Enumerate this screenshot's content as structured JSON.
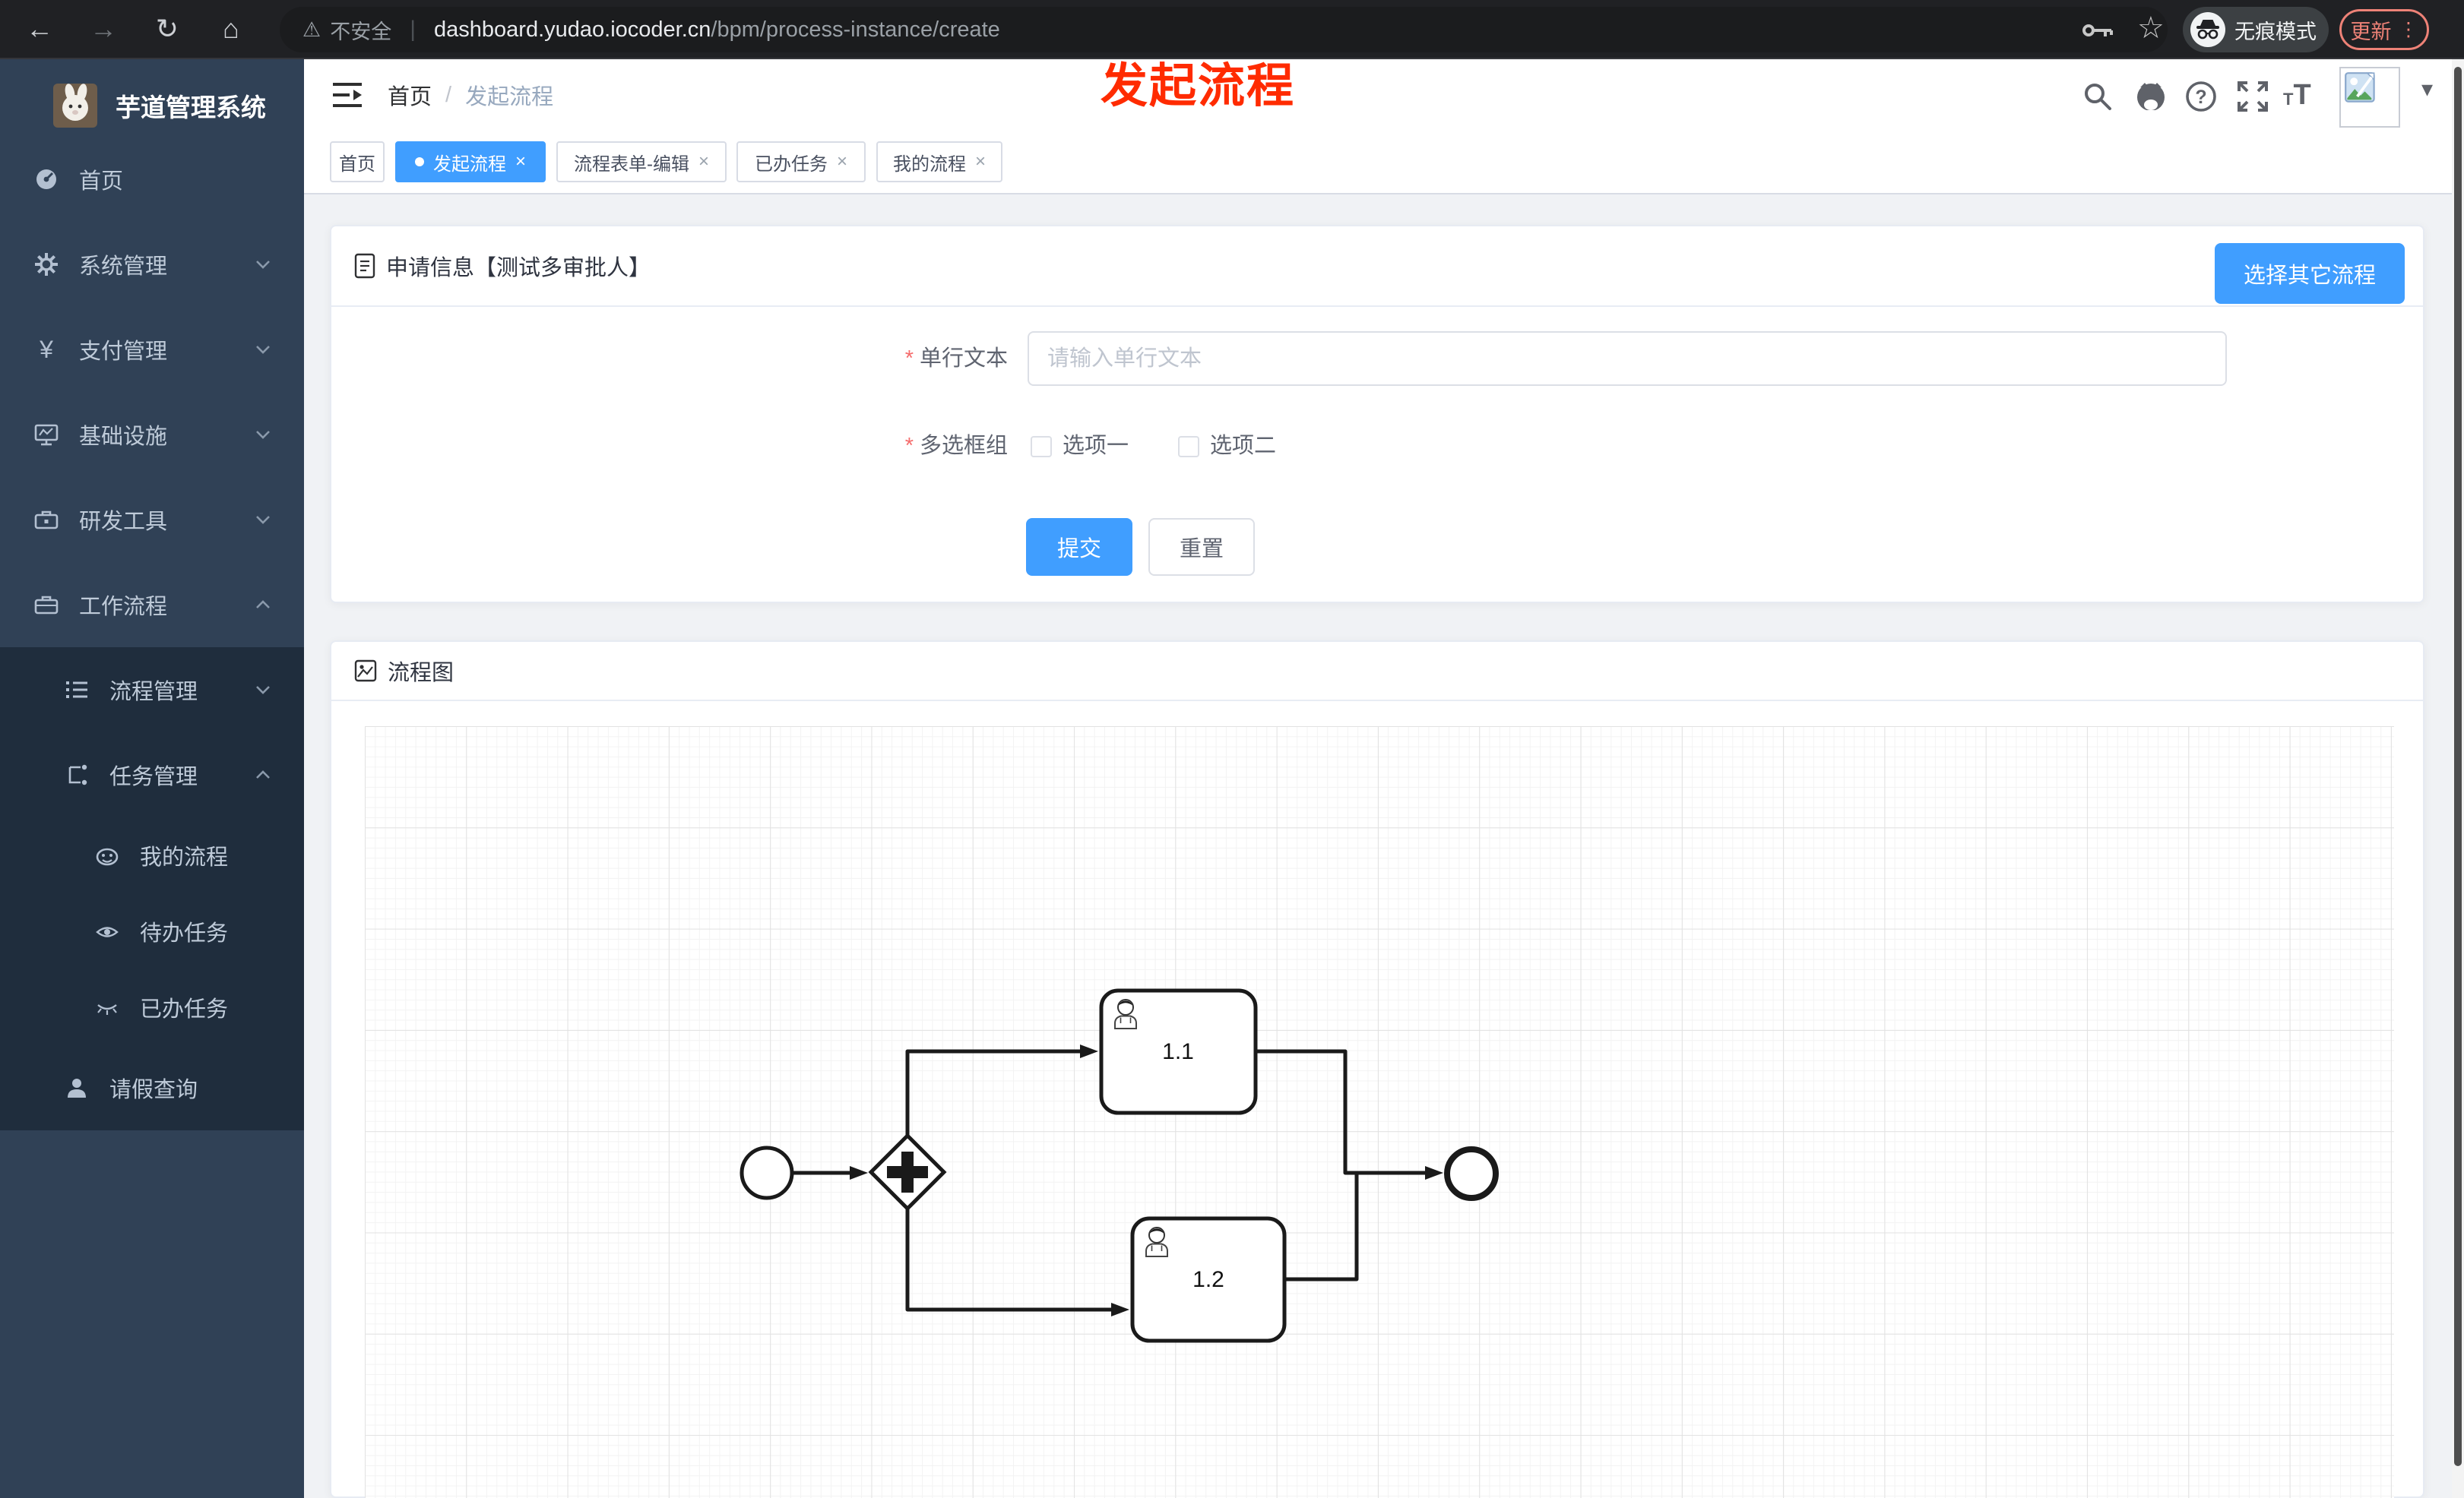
{
  "browser": {
    "security_label": "不安全",
    "url_host": "dashboard.yudao.iocoder.cn",
    "url_path": "/bpm/process-instance/create",
    "incognito_label": "无痕模式",
    "update_button": "更新"
  },
  "annotation": {
    "text": "发起流程",
    "color": "#ff2b00"
  },
  "glyphs": {
    "back": "←",
    "forward": "→",
    "reload": "↻",
    "home": "⌂",
    "warning": "⚠",
    "url_divider": "|",
    "star": "☆",
    "menu_dots": "⋮",
    "caret_down": "▾",
    "close": "×",
    "help": "?",
    "asterisk": "*",
    "yen": "¥",
    "tt_small": "T",
    "tt_large": "T"
  },
  "sidebar": {
    "title": "芋道管理系统",
    "items": [
      {
        "label": "首页",
        "icon": "dashboard-icon",
        "level": 1
      },
      {
        "label": "系统管理",
        "icon": "gear-icon",
        "level": 1,
        "chevron": "down"
      },
      {
        "label": "支付管理",
        "icon": "yen-icon",
        "level": 1,
        "chevron": "down"
      },
      {
        "label": "基础设施",
        "icon": "monitor-icon",
        "level": 1,
        "chevron": "down"
      },
      {
        "label": "研发工具",
        "icon": "toolbox-icon",
        "level": 1,
        "chevron": "down"
      },
      {
        "label": "工作流程",
        "icon": "briefcase-icon",
        "level": 1,
        "chevron": "up"
      },
      {
        "label": "流程管理",
        "icon": "flow-list-icon",
        "level": 2,
        "chevron": "down"
      },
      {
        "label": "任务管理",
        "icon": "task-tree-icon",
        "level": 2,
        "chevron": "up"
      },
      {
        "label": "我的流程",
        "icon": "robot-icon",
        "level": 3
      },
      {
        "label": "待办任务",
        "icon": "eye-icon",
        "level": 3
      },
      {
        "label": "已办任务",
        "icon": "eye-closed-icon",
        "level": 3
      },
      {
        "label": "请假查询",
        "icon": "person-icon",
        "level": 2
      }
    ]
  },
  "header": {
    "breadcrumb": [
      "首页",
      "发起流程"
    ]
  },
  "tabs": [
    {
      "label": "首页",
      "active": false,
      "closable": false
    },
    {
      "label": "发起流程",
      "active": true,
      "closable": true
    },
    {
      "label": "流程表单-编辑",
      "active": false,
      "closable": true
    },
    {
      "label": "已办任务",
      "active": false,
      "closable": true
    },
    {
      "label": "我的流程",
      "active": false,
      "closable": true
    }
  ],
  "form_card": {
    "title": "申请信息【测试多审批人】",
    "switch_button": "选择其它流程",
    "fields": {
      "text": {
        "label": "单行文本",
        "placeholder": "请输入单行文本",
        "value": "",
        "required": true
      },
      "checkbox_group": {
        "label": "多选框组",
        "required": true,
        "options": [
          {
            "label": "选项一",
            "checked": false
          },
          {
            "label": "选项二",
            "checked": false
          }
        ]
      }
    },
    "submit": "提交",
    "reset": "重置"
  },
  "diagram_card": {
    "title": "流程图",
    "diagram": {
      "type": "bpmn",
      "nodes": [
        {
          "id": "start",
          "type": "startEvent",
          "label": ""
        },
        {
          "id": "gateway",
          "type": "parallelGateway",
          "label": ""
        },
        {
          "id": "task1",
          "type": "userTask",
          "label": "1.1"
        },
        {
          "id": "task2",
          "type": "userTask",
          "label": "1.2"
        },
        {
          "id": "end",
          "type": "endEvent",
          "label": ""
        }
      ],
      "flows": [
        "start->gateway",
        "gateway->task1",
        "gateway->task2",
        "task1->end",
        "task2->end"
      ]
    }
  },
  "colors": {
    "primary": "#409eff",
    "danger": "#f56c6c",
    "annotation": "#ff2b00",
    "sidebar_bg": "#304156",
    "submenu_bg": "#1f2d3d",
    "chrome_bg": "#202124"
  }
}
